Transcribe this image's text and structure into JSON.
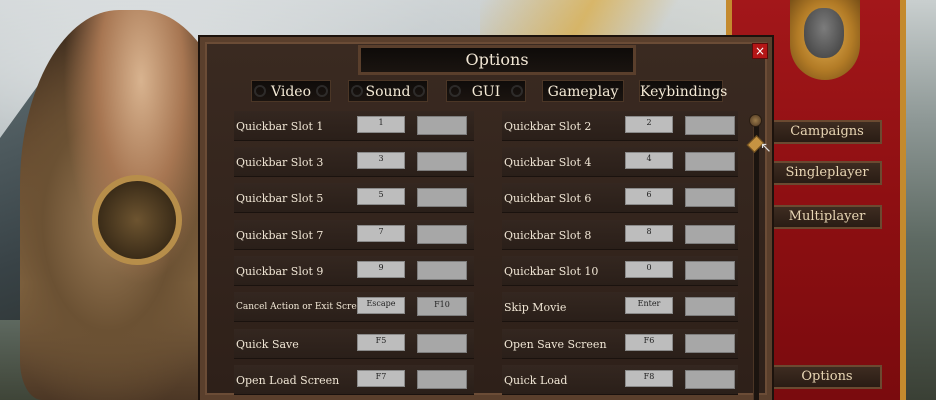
{
  "dialog": {
    "title": "Options",
    "close_label": "×",
    "tabs": [
      "Video",
      "Sound",
      "GUI",
      "Gameplay",
      "Keybindings"
    ]
  },
  "bindings_left": [
    {
      "label": "Quickbar Slot 1",
      "primary": "1",
      "secondary": ""
    },
    {
      "label": "Quickbar Slot 3",
      "primary": "3",
      "secondary": ""
    },
    {
      "label": "Quickbar Slot 5",
      "primary": "5",
      "secondary": ""
    },
    {
      "label": "Quickbar Slot 7",
      "primary": "7",
      "secondary": ""
    },
    {
      "label": "Quickbar Slot 9",
      "primary": "9",
      "secondary": ""
    },
    {
      "label": "Cancel Action or Exit Screen",
      "primary": "Escape",
      "secondary": "F10"
    },
    {
      "label": "Quick Save",
      "primary": "F5",
      "secondary": ""
    },
    {
      "label": "Open Load Screen",
      "primary": "F7",
      "secondary": ""
    }
  ],
  "bindings_right": [
    {
      "label": "Quickbar Slot 2",
      "primary": "2",
      "secondary": ""
    },
    {
      "label": "Quickbar Slot 4",
      "primary": "4",
      "secondary": ""
    },
    {
      "label": "Quickbar Slot 6",
      "primary": "6",
      "secondary": ""
    },
    {
      "label": "Quickbar Slot 8",
      "primary": "8",
      "secondary": ""
    },
    {
      "label": "Quickbar Slot 10",
      "primary": "0",
      "secondary": ""
    },
    {
      "label": "Skip Movie",
      "primary": "Enter",
      "secondary": ""
    },
    {
      "label": "Open Save Screen",
      "primary": "F6",
      "secondary": ""
    },
    {
      "label": "Quick Load",
      "primary": "F8",
      "secondary": ""
    }
  ],
  "main_menu": {
    "campaigns": "Campaigns",
    "singleplayer": "Singleplayer",
    "multiplayer": "Multiplayer",
    "options": "Options"
  },
  "colors": {
    "banner_red": "#9a1215",
    "gold_trim": "#c48a2e",
    "dialog_bg": "#2e2019",
    "close_red": "#b41616"
  }
}
